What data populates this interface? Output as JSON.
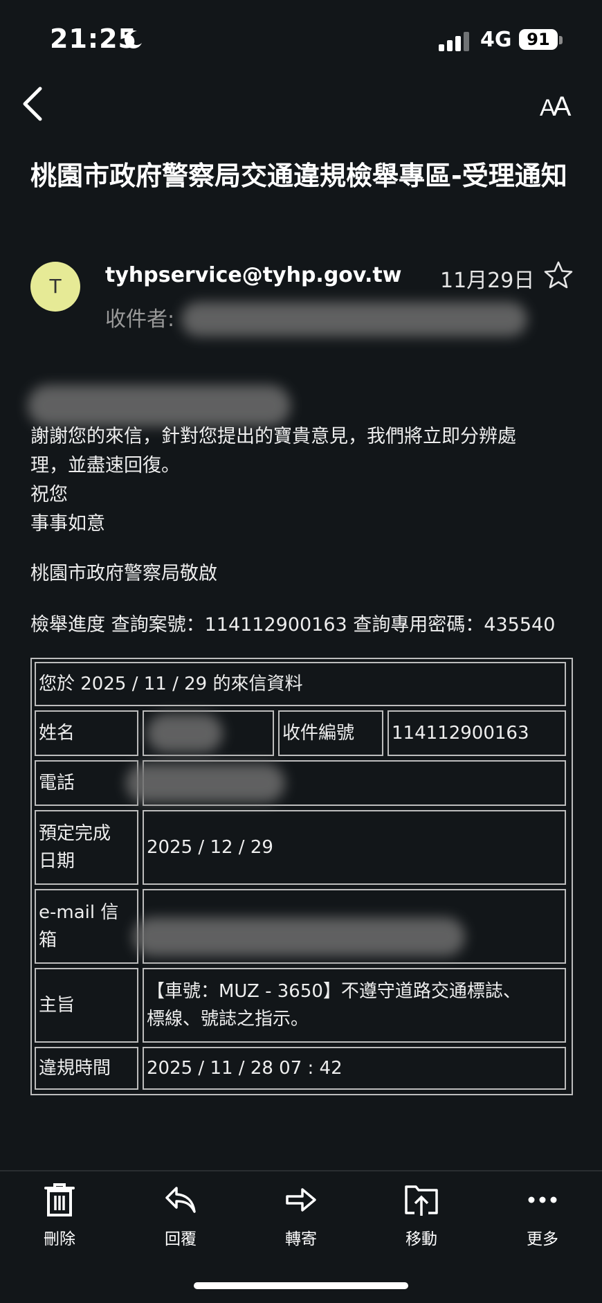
{
  "status_bar": {
    "time": "21:25",
    "network": "4G",
    "battery": "91"
  },
  "subject": "桃園市政府警察局交通違規檢舉專區-受理通知",
  "sender": {
    "avatar_letter": "T",
    "email": "tyhpservice@tyhp.gov.tw",
    "date": "11月29日",
    "to_label": "收件者:"
  },
  "body": {
    "line1": "謝謝您的來信，針對您提出的寶貴意見，我們將立即分辨處",
    "line2": "理，並盡速回復。",
    "line3": "祝您",
    "line4": "事事如意",
    "signature": "桃園市政府警察局敬啟",
    "progress": "檢舉進度 查詢案號：114112900163 查詢專用密碼：435540"
  },
  "table": {
    "header": "您於 2025 / 11 / 29 的來信資料",
    "name_label": "姓名",
    "case_no_label": "收件編號",
    "case_no": "114112900163",
    "phone_label": "電話",
    "due_label_1": "預定完成",
    "due_label_2": "日期",
    "due_date": "2025 / 12 / 29",
    "email_label_1": "e-mail 信",
    "email_label_2": "箱",
    "subject_label": "主旨",
    "subject_line1": "【車號：MUZ - 3650】不遵守道路交通標誌、",
    "subject_line2": "標線、號誌之指示。",
    "violation_label": "違規時間",
    "violation_time": "2025 / 11 / 28 07 : 42"
  },
  "toolbar": {
    "delete": "刪除",
    "reply": "回覆",
    "forward": "轉寄",
    "move": "移動",
    "more": "更多"
  }
}
